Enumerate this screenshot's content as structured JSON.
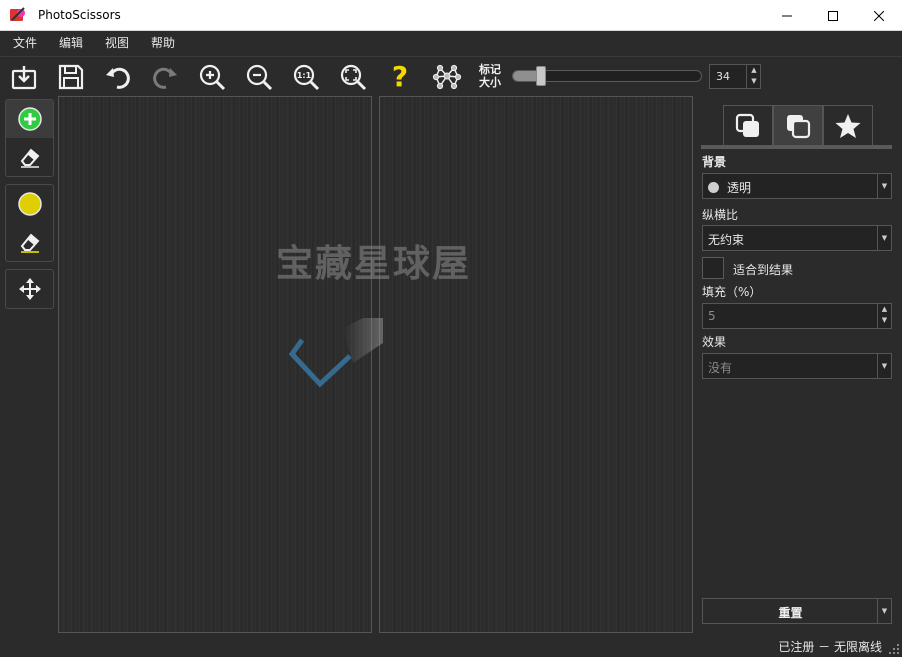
{
  "window": {
    "title": "PhotoScissors"
  },
  "menu": {
    "items": [
      "文件",
      "编辑",
      "视图",
      "帮助"
    ]
  },
  "toolbar": {
    "icons": [
      "import-icon",
      "save-icon",
      "undo-icon",
      "redo-icon",
      "zoom-in-icon",
      "zoom-out-icon",
      "zoom-actual-icon",
      "zoom-fit-icon",
      "help-icon",
      "network-icon"
    ],
    "zoom_actual_text": "1:1",
    "help_text": "?",
    "marker_size_label_line1": "标记",
    "marker_size_label_line2": "大小",
    "marker_size_value": "34",
    "marker_size_fraction": 0.13
  },
  "tools": {
    "foreground_add_icon": "plus-circle-icon",
    "background_mark_icon": "yellow-circle-icon"
  },
  "watermark": {
    "text": "宝藏星球屋"
  },
  "right_panel": {
    "tabs": [
      "background-tab",
      "foreground-tab",
      "favorites-tab"
    ],
    "background_label": "背景",
    "background_value": "透明",
    "aspect_label": "纵横比",
    "aspect_value": "无约束",
    "fit_label": "适合到结果",
    "padding_label": "填充（%）",
    "padding_value": "5",
    "effect_label": "效果",
    "effect_value": "没有",
    "reset_label": "重置"
  },
  "status": {
    "text": "已注册 － 无限离线"
  },
  "colors": {
    "accent_green": "#2ecc40",
    "accent_yellow": "#f5d800",
    "bg": "#2b2b2b"
  }
}
